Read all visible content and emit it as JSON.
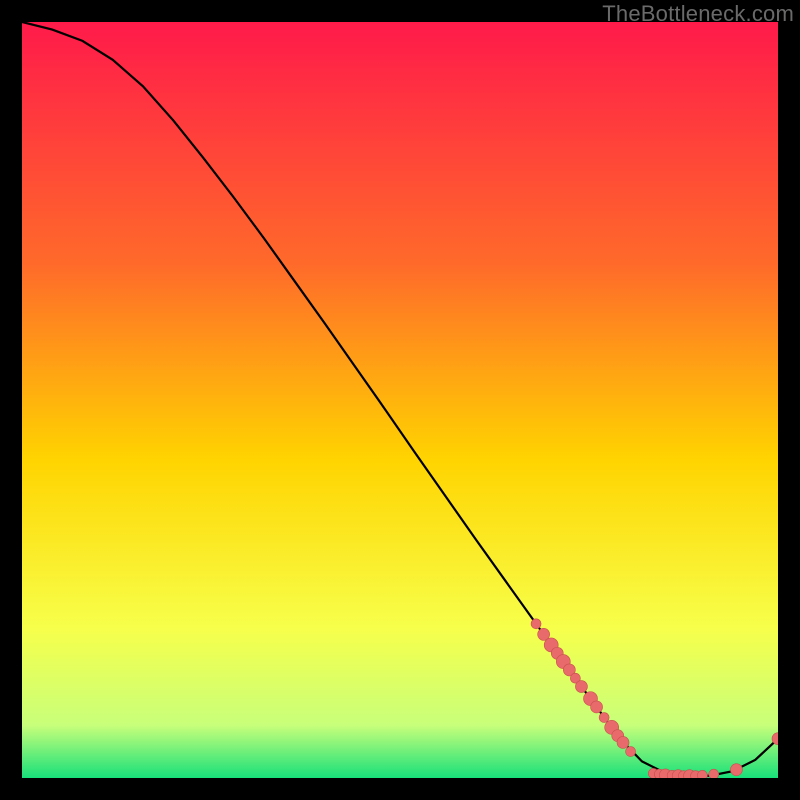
{
  "watermark": "TheBottleneck.com",
  "colors": {
    "background": "#000000",
    "gradient_top": "#ff1a4a",
    "gradient_mid1": "#ff6a2a",
    "gradient_mid2": "#ffd400",
    "gradient_mid3": "#f7ff4a",
    "gradient_bottom_band": "#c8ff7a",
    "gradient_bottom": "#18e07a",
    "curve": "#000000",
    "marker_fill": "#e86a6a",
    "marker_stroke": "#c94f4f"
  },
  "chart_data": {
    "type": "line",
    "title": "",
    "xlabel": "",
    "ylabel": "",
    "xlim": [
      0,
      100
    ],
    "ylim": [
      0,
      100
    ],
    "series": [
      {
        "name": "curve",
        "x": [
          0,
          4,
          8,
          12,
          16,
          20,
          24,
          28,
          32,
          36,
          40,
          44,
          48,
          52,
          56,
          60,
          64,
          68,
          72,
          76,
          79,
          82,
          85,
          88,
          91,
          94,
          97,
          100
        ],
        "y": [
          100,
          99.0,
          97.5,
          95.0,
          91.5,
          87.0,
          82.0,
          76.8,
          71.4,
          65.8,
          60.2,
          54.5,
          48.8,
          43.0,
          37.3,
          31.6,
          26.0,
          20.4,
          14.8,
          9.4,
          5.3,
          2.2,
          0.7,
          0.3,
          0.3,
          0.9,
          2.4,
          5.2
        ]
      }
    ],
    "markers": [
      {
        "x": 68.0,
        "y": 20.4,
        "r": 5
      },
      {
        "x": 69.0,
        "y": 19.0,
        "r": 6
      },
      {
        "x": 70.0,
        "y": 17.6,
        "r": 7
      },
      {
        "x": 70.8,
        "y": 16.5,
        "r": 6
      },
      {
        "x": 71.6,
        "y": 15.4,
        "r": 7
      },
      {
        "x": 72.4,
        "y": 14.3,
        "r": 6
      },
      {
        "x": 73.2,
        "y": 13.2,
        "r": 5
      },
      {
        "x": 74.0,
        "y": 12.1,
        "r": 6
      },
      {
        "x": 75.2,
        "y": 10.5,
        "r": 7
      },
      {
        "x": 76.0,
        "y": 9.4,
        "r": 6
      },
      {
        "x": 77.0,
        "y": 8.0,
        "r": 5
      },
      {
        "x": 78.0,
        "y": 6.7,
        "r": 7
      },
      {
        "x": 78.8,
        "y": 5.6,
        "r": 6
      },
      {
        "x": 79.5,
        "y": 4.7,
        "r": 6
      },
      {
        "x": 80.5,
        "y": 3.5,
        "r": 5
      },
      {
        "x": 83.5,
        "y": 0.6,
        "r": 5
      },
      {
        "x": 84.3,
        "y": 0.5,
        "r": 5
      },
      {
        "x": 85.1,
        "y": 0.4,
        "r": 6
      },
      {
        "x": 86.0,
        "y": 0.35,
        "r": 5
      },
      {
        "x": 86.8,
        "y": 0.3,
        "r": 6
      },
      {
        "x": 87.5,
        "y": 0.3,
        "r": 5
      },
      {
        "x": 88.3,
        "y": 0.3,
        "r": 6
      },
      {
        "x": 89.1,
        "y": 0.3,
        "r": 5
      },
      {
        "x": 90.0,
        "y": 0.35,
        "r": 5
      },
      {
        "x": 91.5,
        "y": 0.5,
        "r": 5
      },
      {
        "x": 94.5,
        "y": 1.1,
        "r": 6
      },
      {
        "x": 100.0,
        "y": 5.2,
        "r": 6
      }
    ]
  }
}
